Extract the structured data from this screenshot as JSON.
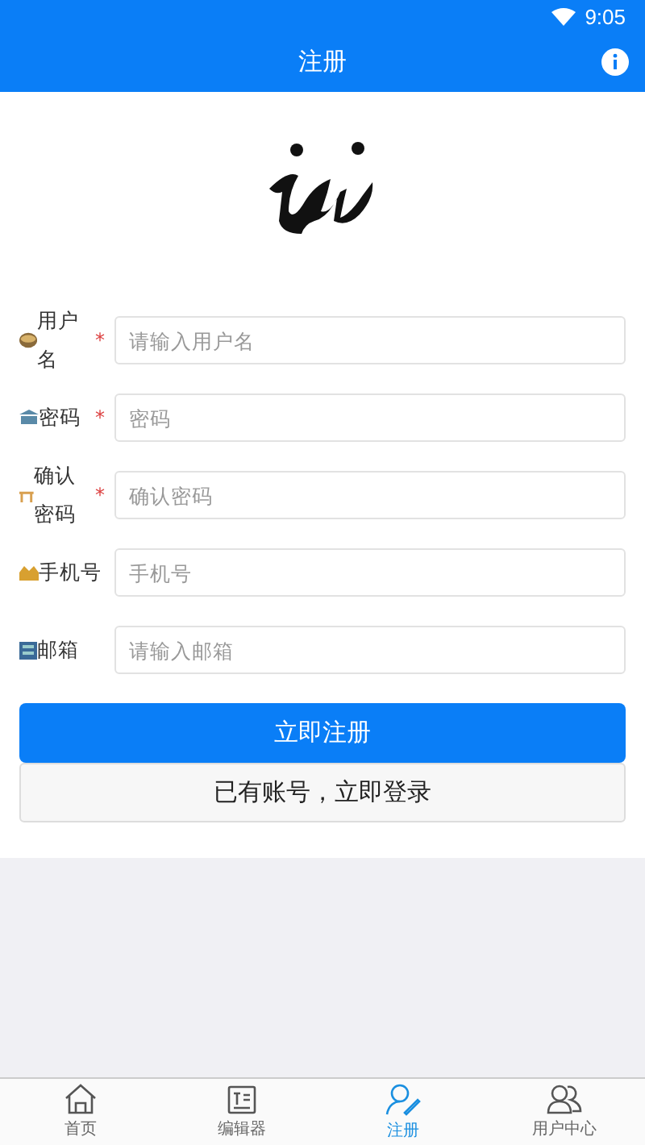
{
  "status_bar": {
    "time": "9:05"
  },
  "header": {
    "title": "注册"
  },
  "form": {
    "fields": [
      {
        "label": "用户名",
        "required_mark": "*",
        "placeholder": "请输入用户名"
      },
      {
        "label": "密码",
        "required_mark": "*",
        "placeholder": "密码"
      },
      {
        "label": "确认密码",
        "required_mark": "*",
        "placeholder": "确认密码"
      },
      {
        "label": "手机号",
        "placeholder": "手机号"
      },
      {
        "label": "邮箱",
        "placeholder": "请输入邮箱"
      }
    ]
  },
  "buttons": {
    "register": "立即注册",
    "login": "已有账号，立即登录"
  },
  "tab_bar": [
    {
      "label": "首页",
      "selected": false
    },
    {
      "label": "编辑器",
      "selected": false
    },
    {
      "label": "注册",
      "selected": true
    },
    {
      "label": "用户中心",
      "selected": false
    }
  ]
}
